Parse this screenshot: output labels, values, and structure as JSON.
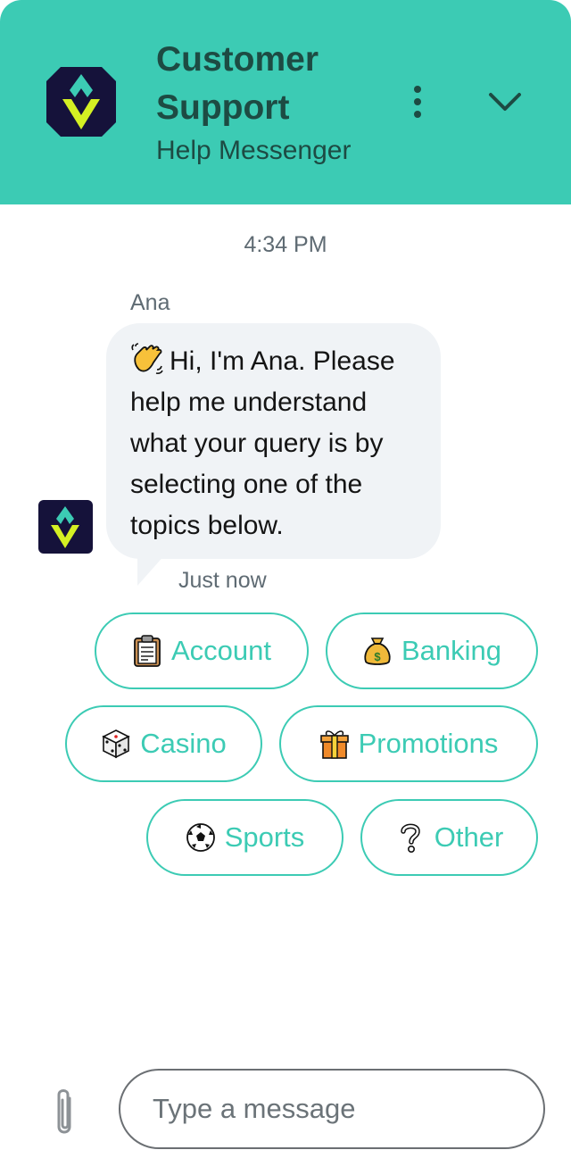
{
  "header": {
    "title": "Customer Support",
    "subtitle": "Help Messenger",
    "logo_icon": "brand-diamond-logo",
    "menu_icon": "more-vertical-icon",
    "collapse_icon": "chevron-down-icon"
  },
  "conversation": {
    "timestamp": "4:34 PM",
    "sender_name": "Ana",
    "message_emoji": "waving-hand",
    "message_text": "Hi, I'm Ana. Please help me understand what your query is by selecting one of the topics below.",
    "sent_time": "Just now"
  },
  "topics": [
    {
      "label": "Account",
      "icon": "clipboard"
    },
    {
      "label": "Banking",
      "icon": "money-bag"
    },
    {
      "label": "Casino",
      "icon": "game-die"
    },
    {
      "label": "Promotions",
      "icon": "wrapped-gift"
    },
    {
      "label": "Sports",
      "icon": "soccer-ball"
    },
    {
      "label": "Other",
      "icon": "question-mark"
    }
  ],
  "composer": {
    "placeholder": "Type a message",
    "value": "",
    "attach_icon": "paperclip-icon"
  },
  "colors": {
    "accent": "#3ccbb4",
    "header_text": "#1d4b43",
    "bubble_bg": "#f0f3f6",
    "logo_bg": "#15123a"
  }
}
